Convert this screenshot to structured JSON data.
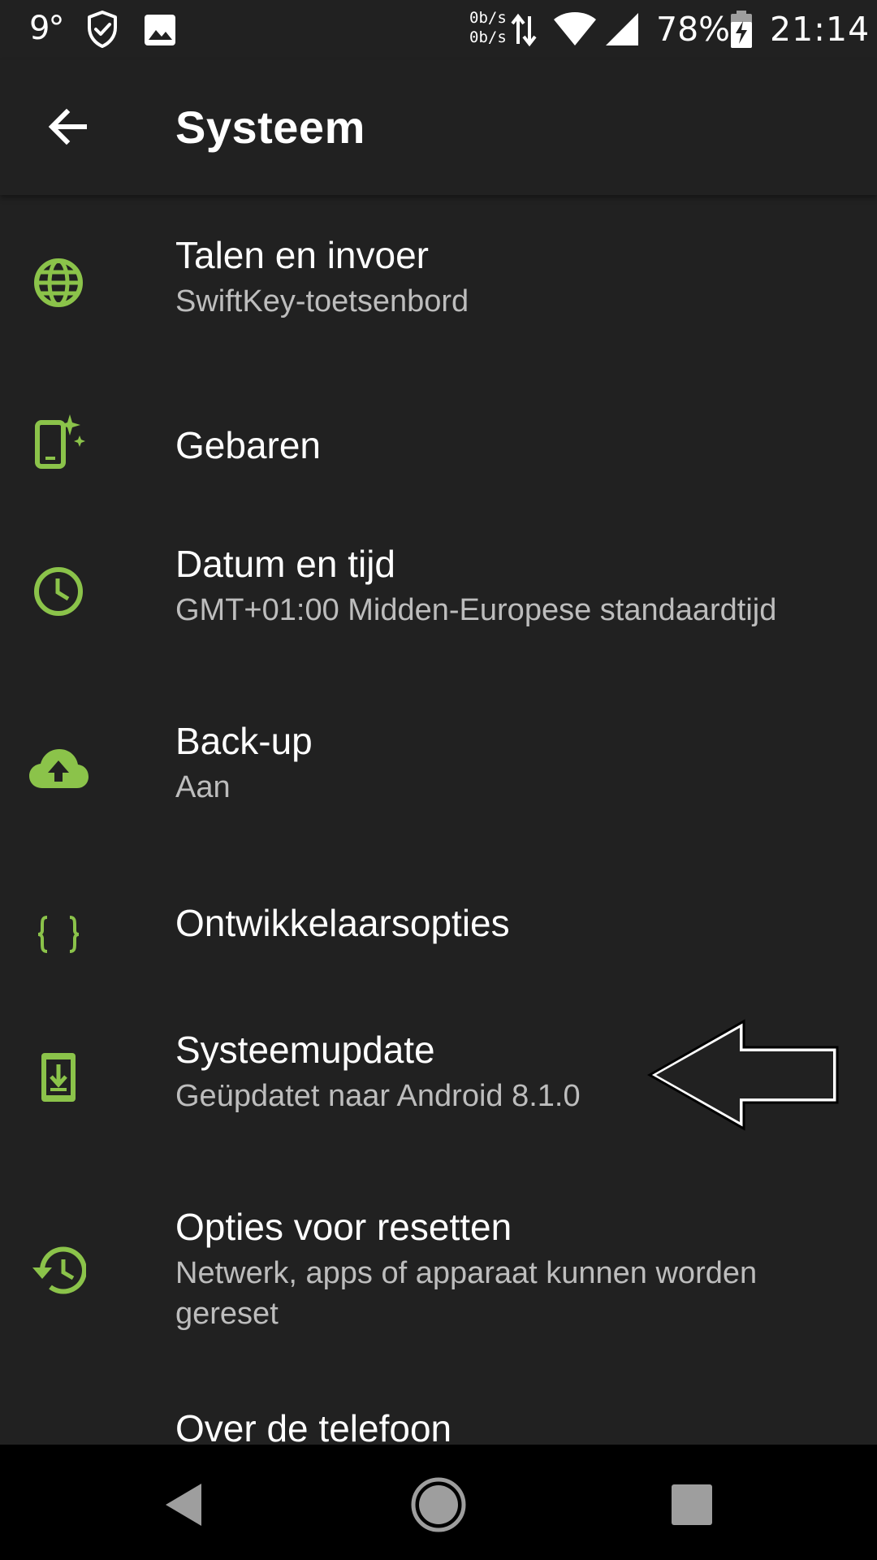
{
  "status_bar": {
    "weather": "9°",
    "net_up": "0b/s",
    "net_down": "0b/s",
    "battery_percent": "78%",
    "time": "21:14",
    "icons": [
      "weather-icon",
      "shield-check-icon",
      "image-icon",
      "data-transfer-icon",
      "wifi-icon",
      "cell-signal-icon",
      "battery-charging-icon"
    ]
  },
  "toolbar": {
    "title": "Systeem",
    "back_icon": "arrow-back-icon"
  },
  "items": [
    {
      "title": "Talen en invoer",
      "summary": "SwiftKey-toetsenbord",
      "icon": "globe-icon"
    },
    {
      "title": "Gebaren",
      "summary": "",
      "icon": "gestures-icon"
    },
    {
      "title": "Datum en tijd",
      "summary": "GMT+01:00 Midden-Europese standaardtijd",
      "icon": "clock-icon"
    },
    {
      "title": "Back-up",
      "summary": "Aan",
      "icon": "cloud-upload-icon"
    },
    {
      "title": "Ontwikkelaarsopties",
      "summary": "",
      "icon": "braces-icon"
    },
    {
      "title": "Systeemupdate",
      "summary": "Geüpdatet naar Android 8.1.0",
      "icon": "system-update-icon"
    },
    {
      "title": "Opties voor resetten",
      "summary": "Netwerk, apps of apparaat kunnen worden gereset",
      "icon": "restore-icon"
    },
    {
      "title": "Over de telefoon",
      "summary": "",
      "icon": "phone-info-icon"
    }
  ],
  "colors": {
    "background": "#212121",
    "accent": "#8bc34a",
    "primary_text": "#ffffff",
    "secondary_text": "#bdbdbd",
    "nav_bar": "#000000"
  },
  "nav_bar": {
    "buttons": [
      "nav-back-icon",
      "nav-home-icon",
      "nav-recents-icon"
    ]
  }
}
